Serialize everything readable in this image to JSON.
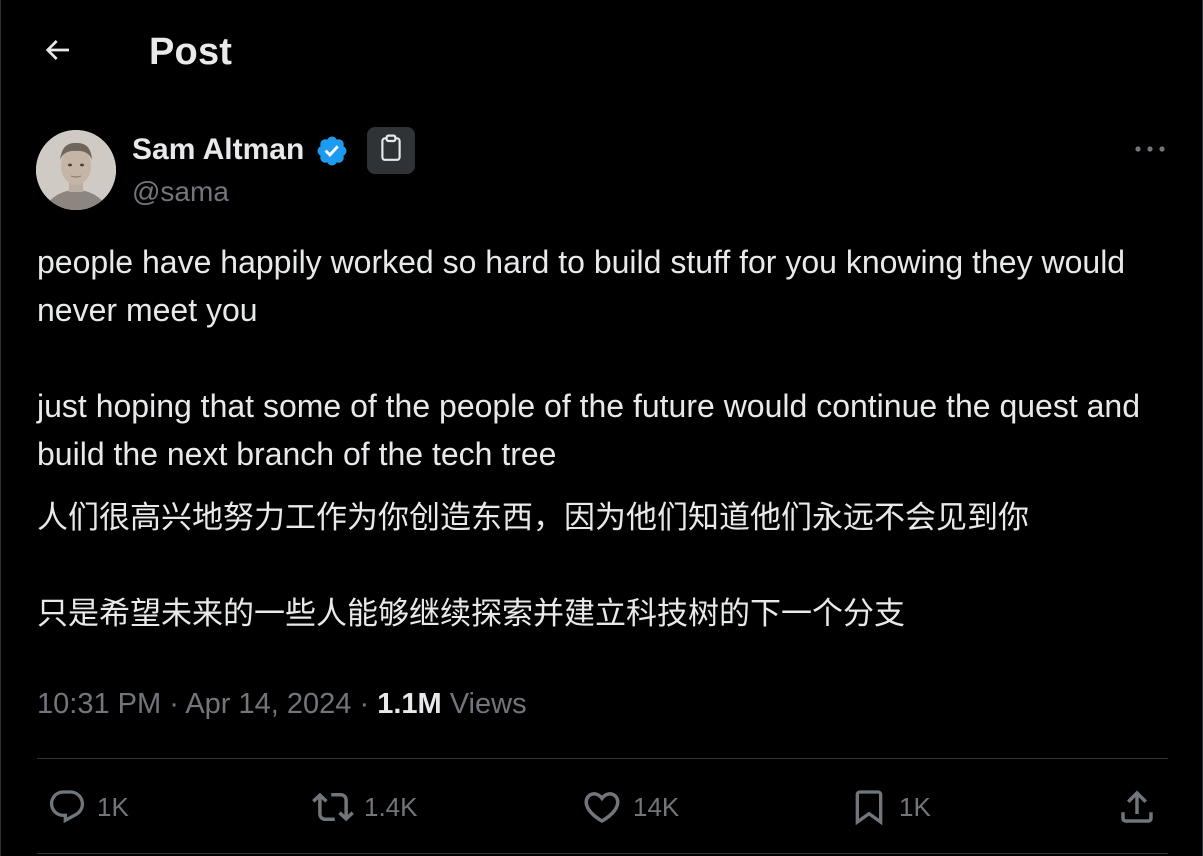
{
  "header": {
    "back_icon": "arrow-left-icon",
    "title": "Post"
  },
  "author": {
    "name": "Sam Altman",
    "handle": "@sama",
    "verified_icon": "verified-badge-icon",
    "verified_color": "#1d9bf0",
    "affiliation_icon": "clipboard-icon",
    "more_icon": "more-horizontal-icon"
  },
  "tweet": {
    "text_en": "people have happily worked so hard to build stuff for you knowing they would never meet you\n\njust hoping that some of the people of the future would continue the quest and build the next branch of the tech tree",
    "text_zh": "人们很高兴地努力工作为你创造东西，因为他们知道他们永远不会见到你\n\n只是希望未来的一些人能够继续探索并建立科技树的下一个分支",
    "time": "10:31 PM",
    "separator": "·",
    "date": "Apr 14, 2024",
    "views_count": "1.1M",
    "views_label": "Views"
  },
  "actions": {
    "reply": {
      "icon": "reply-icon",
      "count": "1K"
    },
    "repost": {
      "icon": "repost-icon",
      "count": "1.4K"
    },
    "like": {
      "icon": "heart-icon",
      "count": "14K"
    },
    "bookmark": {
      "icon": "bookmark-icon",
      "count": "1K"
    },
    "share": {
      "icon": "share-icon"
    }
  },
  "colors": {
    "background": "#000000",
    "text_primary": "#e7e9ea",
    "text_secondary": "#71767b",
    "border": "#2f3336"
  }
}
